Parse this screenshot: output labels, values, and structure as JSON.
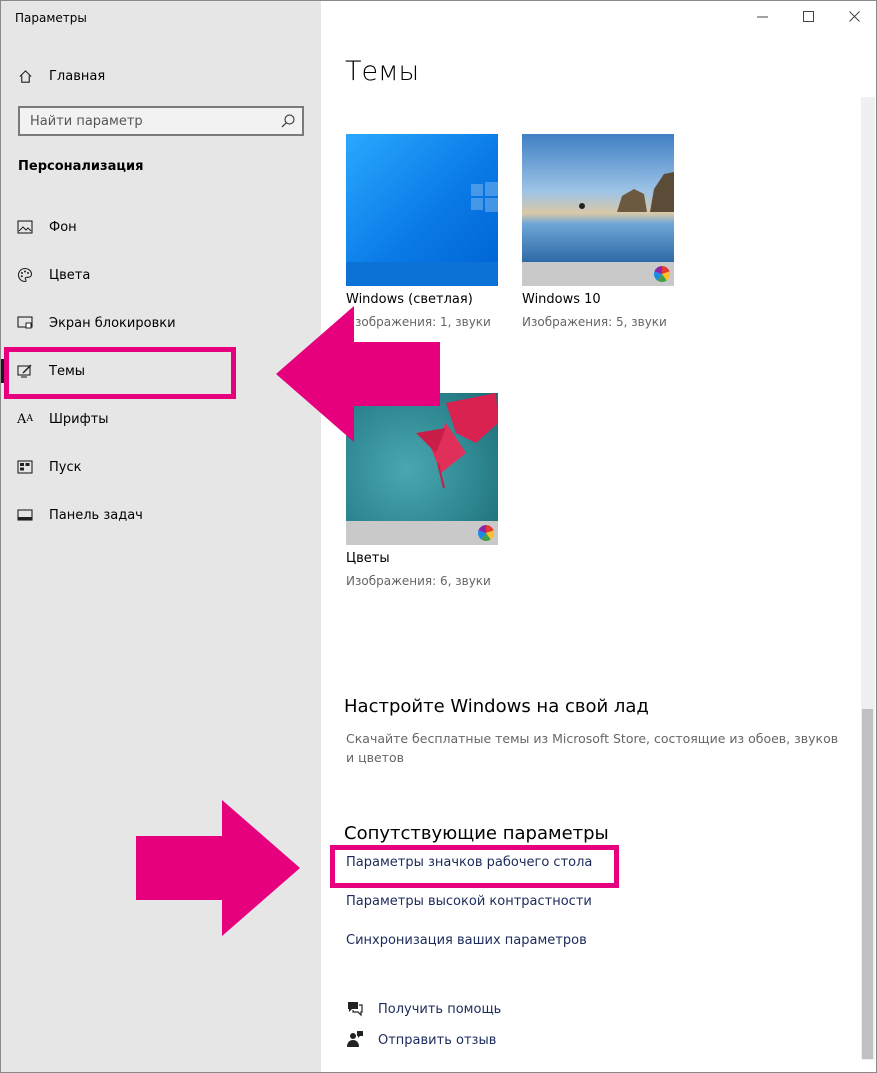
{
  "window": {
    "title": "Параметры"
  },
  "sidebar": {
    "home_label": "Главная",
    "search_placeholder": "Найти параметр",
    "section_title": "Персонализация",
    "items": [
      {
        "label": "Фон",
        "icon": "image-icon"
      },
      {
        "label": "Цвета",
        "icon": "palette-icon"
      },
      {
        "label": "Экран блокировки",
        "icon": "lock-screen-icon"
      },
      {
        "label": "Темы",
        "icon": "themes-icon",
        "selected": true
      },
      {
        "label": "Шрифты",
        "icon": "fonts-icon"
      },
      {
        "label": "Пуск",
        "icon": "start-icon"
      },
      {
        "label": "Панель задач",
        "icon": "taskbar-icon"
      }
    ]
  },
  "main": {
    "title": "Темы",
    "themes": [
      {
        "name": "Windows (светлая)",
        "meta": "Изображения: 1, звуки"
      },
      {
        "name": "Windows 10",
        "meta": "Изображения: 5, звуки"
      },
      {
        "name": "Цветы",
        "meta": "Изображения: 6, звуки"
      }
    ],
    "store_heading": "Настройте Windows на свой лад",
    "store_desc": "Скачайте бесплатные темы из Microsoft Store, состоящие из обоев, звуков и цветов",
    "related_heading": "Сопутствующие параметры",
    "links": [
      "Параметры значков рабочего стола",
      "Параметры высокой контрастности",
      "Синхронизация ваших параметров"
    ],
    "help": [
      {
        "label": "Получить помощь",
        "icon": "help-chat-icon"
      },
      {
        "label": "Отправить отзыв",
        "icon": "feedback-icon"
      }
    ]
  },
  "colors": {
    "accent_pink": "#e6007e",
    "sidebar_bg": "#e6e6e6",
    "link": "#1b2a5a"
  }
}
